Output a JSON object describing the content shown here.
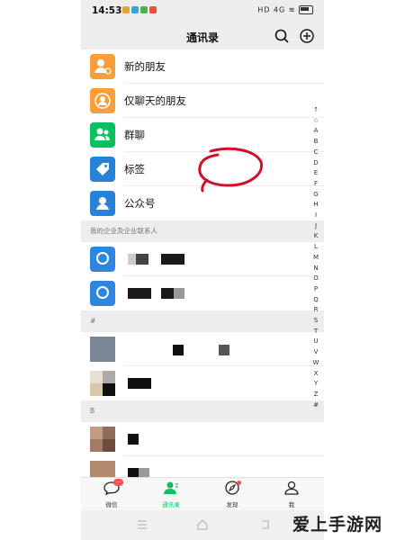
{
  "status_bar": {
    "time": "14:53",
    "right": "HD  4G  ≋"
  },
  "header": {
    "title": "通讯录",
    "search_icon": "search-icon",
    "add_icon": "plus-circle-icon"
  },
  "top_items": [
    {
      "label": "新的朋友",
      "icon": "new-friend-icon",
      "color": "#fa9d3b"
    },
    {
      "label": "仅聊天的朋友",
      "icon": "chat-only-friend-icon",
      "color": "#fa9d3b"
    },
    {
      "label": "群聊",
      "icon": "group-chat-icon",
      "color": "#07c160"
    },
    {
      "label": "标签",
      "icon": "tag-icon",
      "color": "#2782d7"
    },
    {
      "label": "公众号",
      "icon": "official-account-icon",
      "color": "#2782d7"
    }
  ],
  "sections": {
    "enterprise": "我的企业及企业联系人",
    "hash": "#",
    "b": "B"
  },
  "alphabet_index": [
    "↑",
    "☆",
    "A",
    "B",
    "C",
    "D",
    "E",
    "F",
    "G",
    "H",
    "I",
    "J",
    "K",
    "L",
    "M",
    "N",
    "O",
    "P",
    "Q",
    "R",
    "S",
    "T",
    "U",
    "V",
    "W",
    "X",
    "Y",
    "Z",
    "#"
  ],
  "tabs": [
    {
      "label": "微信",
      "icon": "chat-bubble-icon",
      "badge": "···"
    },
    {
      "label": "通讯录",
      "icon": "contacts-icon",
      "active": true
    },
    {
      "label": "发现",
      "icon": "compass-icon"
    },
    {
      "label": "我",
      "icon": "person-icon"
    }
  ],
  "watermark": "爱上手游网",
  "colors": {
    "accent": "#07c160",
    "annotation": "#d0102a"
  }
}
